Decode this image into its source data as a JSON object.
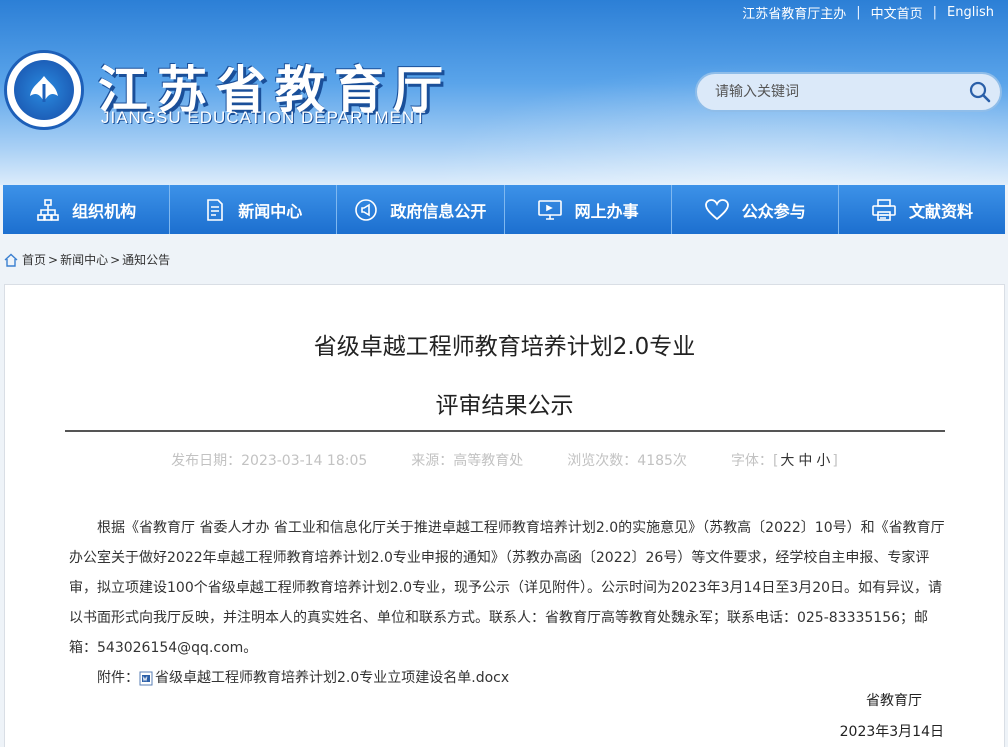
{
  "header": {
    "top_links": [
      "江苏省教育厅主办",
      "中文首页",
      "English"
    ],
    "logo_cn": "江苏省教育厅",
    "logo_en": "JIANGSU EDUCATION DEPARTMENT",
    "search_placeholder": "请输入关键词"
  },
  "nav": [
    {
      "label": "组织机构",
      "icon": "org-chart-icon"
    },
    {
      "label": "新闻中心",
      "icon": "news-document-icon"
    },
    {
      "label": "政府信息公开",
      "icon": "announcement-icon"
    },
    {
      "label": "网上办事",
      "icon": "monitor-icon"
    },
    {
      "label": "公众参与",
      "icon": "heart-icon"
    },
    {
      "label": "文献资料",
      "icon": "printer-icon"
    }
  ],
  "breadcrumb": [
    "首页",
    "新闻中心",
    "通知公告"
  ],
  "article": {
    "title_line1": "省级卓越工程师教育培养计划2.0专业",
    "title_line2": "评审结果公示",
    "meta": {
      "date_label": "发布日期：",
      "date": "2023-03-14 18:05",
      "source_label": "来源：",
      "source": "高等教育处",
      "views_label": "浏览次数：",
      "views": "4185次",
      "font_label": "字体：",
      "font_sizes": [
        "大",
        "中",
        "小"
      ]
    },
    "body": "根据《省教育厅 省委人才办 省工业和信息化厅关于推进卓越工程师教育培养计划2.0的实施意见》（苏教高〔2022〕10号）和《省教育厅办公室关于做好2022年卓越工程师教育培养计划2.0专业申报的通知》（苏教办高函〔2022〕26号）等文件要求，经学校自主申报、专家评审，拟立项建设100个省级卓越工程师教育培养计划2.0专业，现予公示（详见附件）。公示时间为2023年3月14日至3月20日。如有异议，请以书面形式向我厅反映，并注明本人的真实姓名、单位和联系方式。联系人：省教育厅高等教育处魏永军；联系电话：025-83335156；邮箱：543026154@qq.com。",
    "attachment_label": "附件：",
    "attachment_name": "省级卓越工程师教育培养计划2.0专业立项建设名单.docx",
    "signature": "省教育厅",
    "sign_date": "2023年3月14日"
  }
}
